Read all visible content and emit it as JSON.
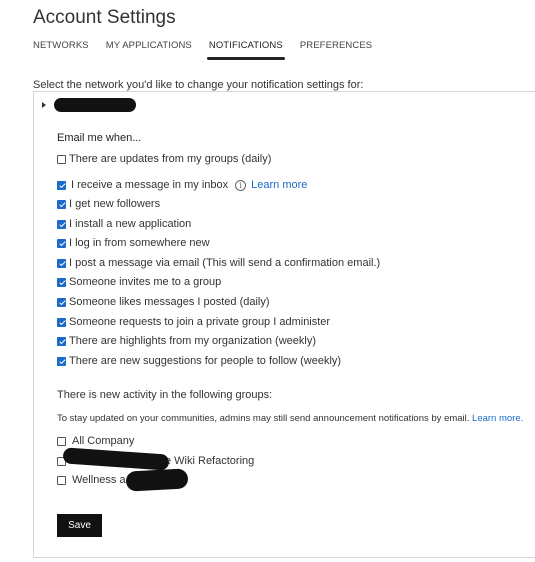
{
  "page": {
    "title": "Account Settings"
  },
  "tabs": [
    {
      "label": "NETWORKS",
      "active": false
    },
    {
      "label": "MY APPLICATIONS",
      "active": false
    },
    {
      "label": "NOTIFICATIONS",
      "active": true
    },
    {
      "label": "PREFERENCES",
      "active": false
    }
  ],
  "prompt": "Select the network you'd like to change your notification settings for:",
  "email_section": {
    "heading": "Email me when...",
    "options": [
      {
        "label": "There are updates from my groups (daily)",
        "checked": false
      },
      {
        "label": "I receive a message in my inbox",
        "checked": true
      },
      {
        "label": "I get new followers",
        "checked": true
      },
      {
        "label": "I install a new application",
        "checked": true
      },
      {
        "label": "I log in from somewhere new",
        "checked": true
      },
      {
        "label": "I post a message via email (This will send a confirmation email.)",
        "checked": true
      },
      {
        "label": "Someone invites me to a group",
        "checked": true
      },
      {
        "label": "Someone likes messages I posted (daily)",
        "checked": true
      },
      {
        "label": "Someone requests to join a private group I administer",
        "checked": true
      },
      {
        "label": "There are highlights from my organization (weekly)",
        "checked": true
      },
      {
        "label": "There are new suggestions for people to follow (weekly)",
        "checked": true
      }
    ],
    "learn_more_label": "Learn more",
    "info_icon": "info-icon"
  },
  "groups_section": {
    "heading": "There is new activity in the following groups:",
    "note": "To stay updated on your communities, admins may still send announcement notifications by email.",
    "note_link": "Learn more.",
    "groups": [
      {
        "label": "All Company",
        "checked": false
      },
      {
        "label": "e Wiki Refactoring",
        "checked": false
      },
      {
        "label": "Wellness a",
        "checked": false
      }
    ]
  },
  "actions": {
    "save_label": "Save"
  }
}
